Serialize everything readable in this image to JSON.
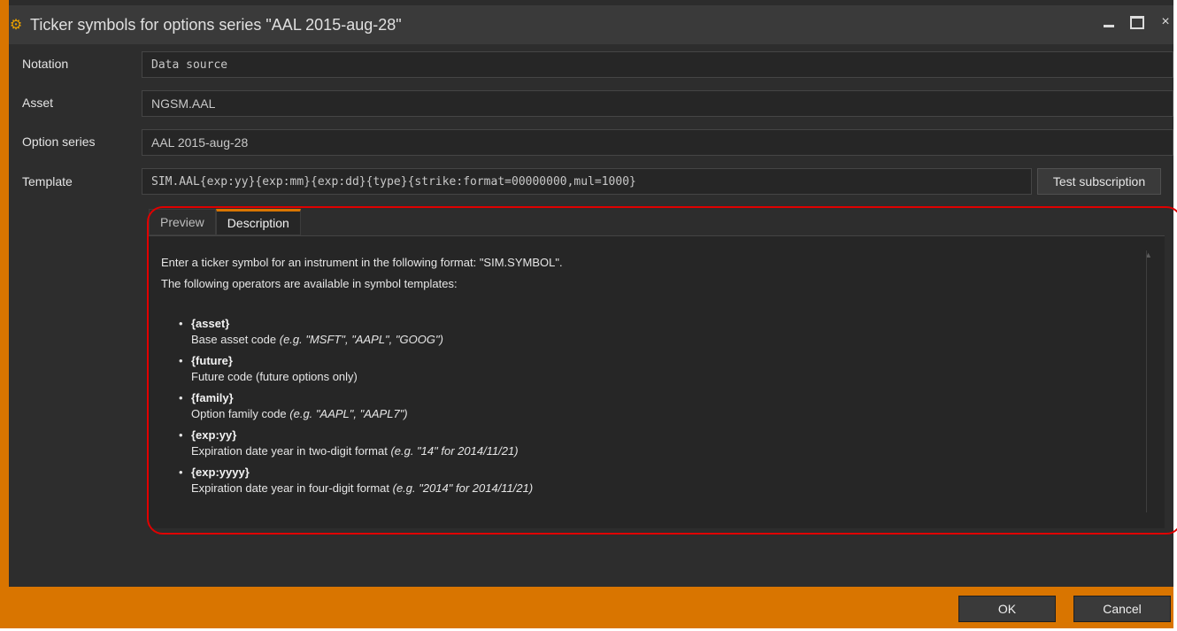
{
  "window": {
    "title": "Ticker symbols for options series \"AAL 2015-aug-28\"",
    "icon": "gear-icon",
    "controls": {
      "minimize": "minimize-icon",
      "maximize": "maximize-icon",
      "close": "close-icon"
    }
  },
  "form": {
    "notation": {
      "label": "Notation",
      "value": "Data source"
    },
    "asset": {
      "label": "Asset",
      "value": "NGSM.AAL"
    },
    "option_series": {
      "label": "Option series",
      "value": "AAL 2015-aug-28"
    },
    "template": {
      "label": "Template",
      "value": "SIM.AAL{exp:yy}{exp:mm}{exp:dd}{type}{strike:format=00000000,mul=1000}"
    },
    "test_subscription_label": "Test subscription"
  },
  "tabs": [
    {
      "label": "Preview",
      "active": false
    },
    {
      "label": "Description",
      "active": true
    }
  ],
  "description": {
    "intro1": "Enter a ticker symbol for an instrument in the following format: \"SIM.SYMBOL\".",
    "intro2": "The following operators are available in symbol templates:",
    "operators": [
      {
        "op": "{asset}",
        "text": "Base asset code ",
        "example": "(e.g. \"MSFT\", \"AAPL\", \"GOOG\")"
      },
      {
        "op": "{future}",
        "text": "Future code (future options only)",
        "example": ""
      },
      {
        "op": "{family}",
        "text": "Option family code ",
        "example": "(e.g. \"AAPL\", \"AAPL7\")"
      },
      {
        "op": "{exp:yy}",
        "text": "Expiration date year in two-digit format ",
        "example": "(e.g. \"14\" for 2014/11/21)"
      },
      {
        "op": "{exp:yyyy}",
        "text": "Expiration date year in four-digit format ",
        "example": "(e.g. \"2014\" for 2014/11/21)"
      }
    ]
  },
  "footer": {
    "ok_label": "OK",
    "cancel_label": "Cancel"
  },
  "colors": {
    "accent": "#d97500",
    "background": "#2c2c2c",
    "highlight": "#e00000"
  }
}
